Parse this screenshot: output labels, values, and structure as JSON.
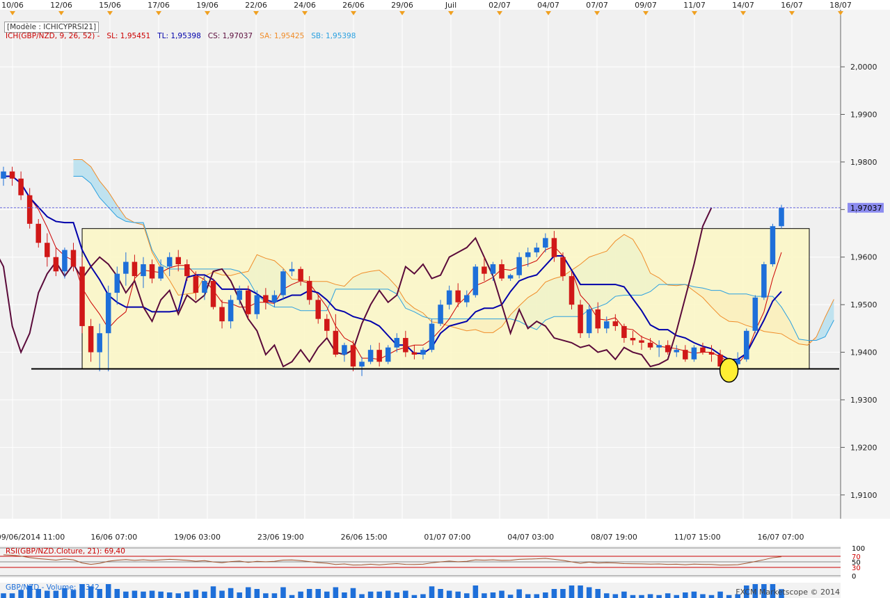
{
  "model_label": "[Modèle : ICHICYPRSI21]",
  "indicator": {
    "name": "ICH(GBP/NZD, 9, 26, 52) -",
    "sl": "SL: 1,95451",
    "tl": "TL: 1,95398",
    "cs": "CS: 1,97037",
    "sa": "SA: 1,95425",
    "sb": "SB: 1,95398"
  },
  "colors": {
    "sl": "#cc0000",
    "tl": "#0000aa",
    "cs": "#5a0a3a",
    "sa": "#f08c28",
    "sb": "#2aa0e0",
    "bull": "#1e6fd9",
    "bear": "#d01818",
    "box": "#fbf6c2",
    "price_tag": "#8c8cf0"
  },
  "top_dates": [
    "10/06",
    "12/06",
    "15/06",
    "17/06",
    "19/06",
    "22/06",
    "24/06",
    "26/06",
    "29/06",
    "Juil",
    "02/07",
    "04/07",
    "07/07",
    "09/07",
    "11/07",
    "14/07",
    "16/07",
    "18/07"
  ],
  "bottom_dates": [
    "09/06/2014 11:00",
    "16/06 07:00",
    "19/06 03:00",
    "23/06 19:00",
    "26/06 15:00",
    "01/07 07:00",
    "04/07 03:00",
    "08/07 19:00",
    "11/07 15:00",
    "16/07 07:00"
  ],
  "price_tag": "1,97037",
  "rsi_label": "RSI(GBP/NZD.Cloture, 21): 69,40",
  "rsi_scale": [
    "100",
    "70",
    "50",
    "30",
    "0"
  ],
  "volume_label": "GBP/NZD - Volume: 1,342",
  "watermark": "FXCM Marketscope © 2014",
  "chart_data": {
    "type": "candlestick",
    "symbol": "GBP/NZD",
    "ylim": [
      1.905,
      2.012
    ],
    "y_ticks": [
      1.91,
      1.92,
      1.93,
      1.94,
      1.95,
      1.96,
      1.97,
      1.98,
      1.99,
      2.0
    ],
    "y_tick_labels": [
      "1,9100",
      "1,9200",
      "1,9300",
      "1,9400",
      "1,9500",
      "1,9600",
      "1,9700",
      "1,9800",
      "1,9900",
      "2,0000"
    ],
    "current_price": 1.97037,
    "candles": [
      [
        1.9765,
        1.979,
        1.975,
        1.978
      ],
      [
        1.978,
        1.979,
        1.975,
        1.9765
      ],
      [
        1.9765,
        1.978,
        1.972,
        1.973
      ],
      [
        1.973,
        1.9745,
        1.966,
        1.967
      ],
      [
        1.967,
        1.968,
        1.962,
        1.963
      ],
      [
        1.963,
        1.965,
        1.958,
        1.96
      ],
      [
        1.96,
        1.962,
        1.956,
        1.957
      ],
      [
        1.957,
        1.962,
        1.9555,
        1.9615
      ],
      [
        1.9615,
        1.963,
        1.957,
        1.958
      ],
      [
        1.958,
        1.96,
        1.944,
        1.9455
      ],
      [
        1.9455,
        1.947,
        1.938,
        1.94
      ],
      [
        1.94,
        1.946,
        1.936,
        1.944
      ],
      [
        1.944,
        1.954,
        1.936,
        1.9525
      ],
      [
        1.9525,
        1.958,
        1.95,
        1.9565
      ],
      [
        1.9565,
        1.961,
        1.954,
        1.959
      ],
      [
        1.959,
        1.9605,
        1.955,
        1.956
      ],
      [
        1.956,
        1.96,
        1.9535,
        1.9585
      ],
      [
        1.9585,
        1.9595,
        1.9545,
        1.9555
      ],
      [
        1.9555,
        1.9595,
        1.955,
        1.958
      ],
      [
        1.958,
        1.961,
        1.956,
        1.96
      ],
      [
        1.96,
        1.9615,
        1.957,
        1.9585
      ],
      [
        1.9585,
        1.9595,
        1.955,
        1.956
      ],
      [
        1.956,
        1.957,
        1.951,
        1.9525
      ],
      [
        1.9525,
        1.956,
        1.951,
        1.955
      ],
      [
        1.955,
        1.9555,
        1.949,
        1.9495
      ],
      [
        1.9495,
        1.951,
        1.945,
        1.9465
      ],
      [
        1.9465,
        1.952,
        1.945,
        1.951
      ],
      [
        1.951,
        1.954,
        1.95,
        1.953
      ],
      [
        1.953,
        1.954,
        1.947,
        1.948
      ],
      [
        1.948,
        1.953,
        1.947,
        1.952
      ],
      [
        1.952,
        1.9535,
        1.949,
        1.9505
      ],
      [
        1.9505,
        1.953,
        1.9495,
        1.952
      ],
      [
        1.952,
        1.9575,
        1.951,
        1.957
      ],
      [
        1.957,
        1.959,
        1.956,
        1.9575
      ],
      [
        1.9575,
        1.958,
        1.954,
        1.955
      ],
      [
        1.955,
        1.956,
        1.95,
        1.951
      ],
      [
        1.951,
        1.952,
        1.946,
        1.947
      ],
      [
        1.947,
        1.948,
        1.943,
        1.9445
      ],
      [
        1.9445,
        1.948,
        1.939,
        1.9395
      ],
      [
        1.9395,
        1.942,
        1.938,
        1.9415
      ],
      [
        1.9415,
        1.9425,
        1.936,
        1.937
      ],
      [
        1.937,
        1.939,
        1.935,
        1.938
      ],
      [
        1.938,
        1.9415,
        1.9375,
        1.9405
      ],
      [
        1.9405,
        1.942,
        1.937,
        1.938
      ],
      [
        1.938,
        1.9415,
        1.9375,
        1.941
      ],
      [
        1.941,
        1.944,
        1.94,
        1.943
      ],
      [
        1.943,
        1.9445,
        1.939,
        1.94
      ],
      [
        1.94,
        1.9415,
        1.9385,
        1.9395
      ],
      [
        1.9395,
        1.941,
        1.9385,
        1.9405
      ],
      [
        1.9405,
        1.947,
        1.94,
        1.946
      ],
      [
        1.946,
        1.951,
        1.9455,
        1.95
      ],
      [
        1.95,
        1.954,
        1.949,
        1.953
      ],
      [
        1.953,
        1.9545,
        1.9495,
        1.9505
      ],
      [
        1.9505,
        1.953,
        1.9495,
        1.952
      ],
      [
        1.952,
        1.9585,
        1.9515,
        1.958
      ],
      [
        1.958,
        1.96,
        1.955,
        1.9565
      ],
      [
        1.9565,
        1.959,
        1.955,
        1.9585
      ],
      [
        1.9585,
        1.9595,
        1.955,
        1.9555
      ],
      [
        1.9555,
        1.9565,
        1.955,
        1.9562
      ],
      [
        1.9562,
        1.961,
        1.9555,
        1.96
      ],
      [
        1.96,
        1.962,
        1.958,
        1.961
      ],
      [
        1.961,
        1.963,
        1.96,
        1.962
      ],
      [
        1.962,
        1.965,
        1.961,
        1.964
      ],
      [
        1.964,
        1.9655,
        1.959,
        1.96
      ],
      [
        1.96,
        1.961,
        1.955,
        1.956
      ],
      [
        1.956,
        1.957,
        1.949,
        1.95
      ],
      [
        1.95,
        1.951,
        1.943,
        1.944
      ],
      [
        1.944,
        1.95,
        1.943,
        1.949
      ],
      [
        1.949,
        1.9505,
        1.944,
        1.945
      ],
      [
        1.945,
        1.9475,
        1.944,
        1.9465
      ],
      [
        1.9465,
        1.948,
        1.9445,
        1.9455
      ],
      [
        1.9455,
        1.946,
        1.942,
        1.943
      ],
      [
        1.943,
        1.9445,
        1.9415,
        1.9425
      ],
      [
        1.9425,
        1.9435,
        1.9405,
        1.942
      ],
      [
        1.942,
        1.943,
        1.9405,
        1.941
      ],
      [
        1.941,
        1.9425,
        1.939,
        1.9415
      ],
      [
        1.9415,
        1.9425,
        1.9395,
        1.94
      ],
      [
        1.94,
        1.9415,
        1.939,
        1.9405
      ],
      [
        1.9405,
        1.9415,
        1.938,
        1.9385
      ],
      [
        1.9385,
        1.9415,
        1.938,
        1.941
      ],
      [
        1.941,
        1.942,
        1.9395,
        1.94
      ],
      [
        1.94,
        1.9415,
        1.938,
        1.9395
      ],
      [
        1.9395,
        1.9405,
        1.936,
        1.937
      ],
      [
        1.937,
        1.9385,
        1.9345,
        1.9375
      ],
      [
        1.9375,
        1.94,
        1.937,
        1.9385
      ],
      [
        1.9385,
        1.945,
        1.938,
        1.9445
      ],
      [
        1.9445,
        1.952,
        1.944,
        1.9515
      ],
      [
        1.9515,
        1.959,
        1.951,
        1.9585
      ],
      [
        1.9585,
        1.967,
        1.958,
        1.9665
      ],
      [
        1.9665,
        1.971,
        1.966,
        1.9704
      ]
    ],
    "range_box": {
      "price_top": 1.966,
      "price_bottom": 1.9365
    },
    "support_level": 1.9365,
    "highlight": "ellipse near 14/07 lows"
  }
}
